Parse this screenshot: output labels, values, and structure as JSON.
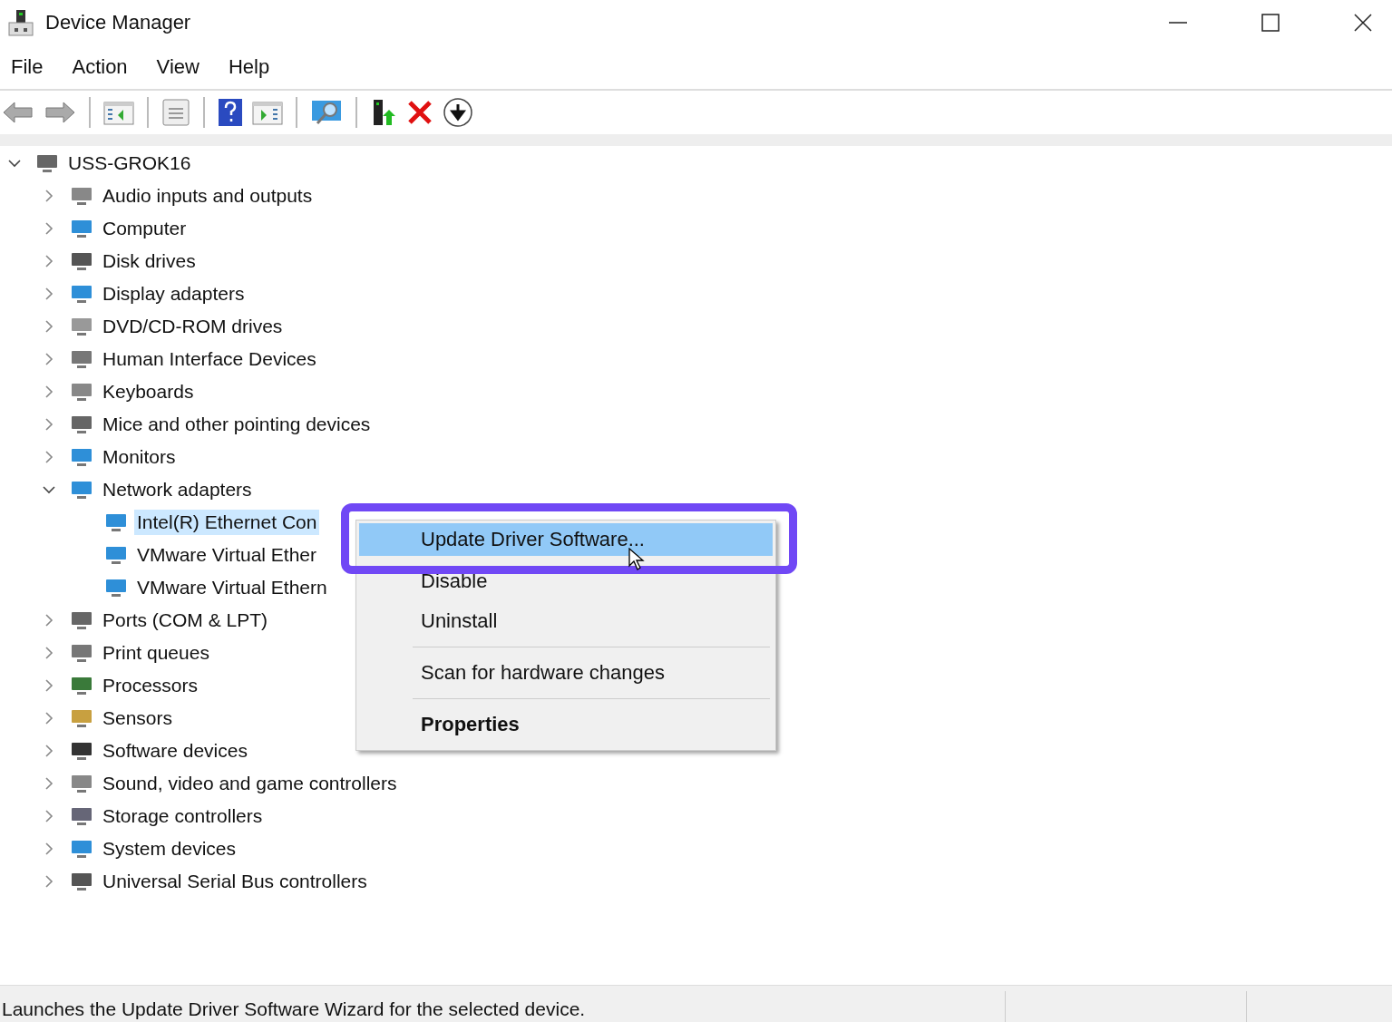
{
  "window": {
    "title": "Device Manager"
  },
  "menu_bar": [
    {
      "label": "File"
    },
    {
      "label": "Action"
    },
    {
      "label": "View"
    },
    {
      "label": "Help"
    }
  ],
  "toolbar": [
    {
      "kind": "back"
    },
    {
      "kind": "forward"
    },
    {
      "kind": "sep"
    },
    {
      "kind": "tree-left"
    },
    {
      "kind": "sep"
    },
    {
      "kind": "properties"
    },
    {
      "kind": "sep"
    },
    {
      "kind": "help"
    },
    {
      "kind": "tree-right"
    },
    {
      "kind": "sep"
    },
    {
      "kind": "scan"
    },
    {
      "kind": "sep"
    },
    {
      "kind": "update"
    },
    {
      "kind": "remove"
    },
    {
      "kind": "download"
    }
  ],
  "tree": [
    {
      "label": "USS-GROK16",
      "kind": "computer",
      "expanded": true,
      "selected": false,
      "children": [
        {
          "label": "Audio inputs and outputs",
          "kind": "speaker",
          "expanded": false,
          "selected": false
        },
        {
          "label": "Computer",
          "kind": "monitor",
          "expanded": false,
          "selected": false
        },
        {
          "label": "Disk drives",
          "kind": "disk",
          "expanded": false,
          "selected": false
        },
        {
          "label": "Display adapters",
          "kind": "monitor",
          "expanded": false,
          "selected": false
        },
        {
          "label": "DVD/CD-ROM drives",
          "kind": "disc",
          "expanded": false,
          "selected": false
        },
        {
          "label": "Human Interface Devices",
          "kind": "hid",
          "expanded": false,
          "selected": false
        },
        {
          "label": "Keyboards",
          "kind": "keyboard",
          "expanded": false,
          "selected": false
        },
        {
          "label": "Mice and other pointing devices",
          "kind": "mouse",
          "expanded": false,
          "selected": false
        },
        {
          "label": "Monitors",
          "kind": "monitor",
          "expanded": false,
          "selected": false
        },
        {
          "label": "Network adapters",
          "kind": "network",
          "expanded": true,
          "selected": false,
          "children": [
            {
              "label": "Intel(R) Ethernet Con",
              "kind": "network",
              "selected": true
            },
            {
              "label": "VMware Virtual Ether",
              "kind": "network",
              "selected": false
            },
            {
              "label": "VMware Virtual Ethern",
              "kind": "network",
              "selected": false
            }
          ]
        },
        {
          "label": "Ports (COM & LPT)",
          "kind": "port",
          "expanded": false,
          "selected": false
        },
        {
          "label": "Print queues",
          "kind": "printer",
          "expanded": false,
          "selected": false
        },
        {
          "label": "Processors",
          "kind": "chip",
          "expanded": false,
          "selected": false
        },
        {
          "label": "Sensors",
          "kind": "sensor",
          "expanded": false,
          "selected": false
        },
        {
          "label": "Software devices",
          "kind": "tower",
          "expanded": false,
          "selected": false
        },
        {
          "label": "Sound, video and game controllers",
          "kind": "speaker",
          "expanded": false,
          "selected": false
        },
        {
          "label": "Storage controllers",
          "kind": "storage",
          "expanded": false,
          "selected": false
        },
        {
          "label": "System devices",
          "kind": "folder",
          "expanded": false,
          "selected": false
        },
        {
          "label": "Universal Serial Bus controllers",
          "kind": "usb",
          "expanded": false,
          "selected": false
        }
      ]
    }
  ],
  "context_menu": [
    {
      "kind": "item",
      "label": "Update Driver Software...",
      "selected": true,
      "default": false
    },
    {
      "kind": "item",
      "label": "Disable",
      "selected": false,
      "default": false
    },
    {
      "kind": "item",
      "label": "Uninstall",
      "selected": false,
      "default": false
    },
    {
      "kind": "separator"
    },
    {
      "kind": "item",
      "label": "Scan for hardware changes",
      "selected": false,
      "default": false
    },
    {
      "kind": "separator"
    },
    {
      "kind": "item",
      "label": "Properties",
      "selected": false,
      "default": true
    }
  ],
  "status_bar": {
    "text": "Launches the Update Driver Software Wizard for the selected device."
  }
}
